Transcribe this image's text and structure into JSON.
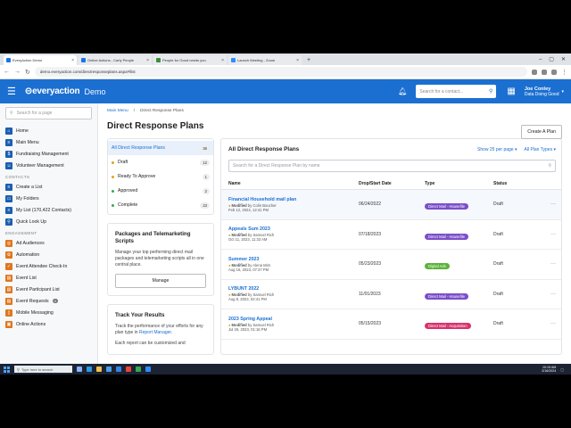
{
  "browser": {
    "tabs": [
      {
        "title": "EveryAction Demo",
        "active": true
      },
      {
        "title": "Online Actions - Carly People",
        "active": false
      },
      {
        "title": "People for Good needs you",
        "active": false
      },
      {
        "title": "Launch Meeting - Zoom",
        "active": false
      }
    ],
    "url": "demo.everyaction.com/directresponseplans.aspx#/list"
  },
  "header": {
    "logo": "everyaction",
    "logo_sub": "Demo",
    "search_placeholder": "Search for a contact...",
    "user_name": "Joe Conley",
    "user_org": "Data Doing Good"
  },
  "sidebar": {
    "search_placeholder": "Search for a page",
    "top_items": [
      "Home",
      "Main Menu",
      "Fundraising Management",
      "Volunteer Management"
    ],
    "contacts_label": "CONTACTS",
    "contacts_items": [
      "Create a List",
      "My Folders",
      "My List (170,422 Contacts)",
      "Quick Look Up"
    ],
    "engagement_label": "ENGAGEMENT",
    "engagement_items": [
      "Ad Audiences",
      "Automation",
      "Event Attendee Check-In",
      "Event List",
      "Event Participant List",
      "Event Requests",
      "Mobile Messaging",
      "Online Actions"
    ],
    "event_requests_badge": "0"
  },
  "main": {
    "breadcrumb_root": "Main Menu",
    "breadcrumb_sep": "/",
    "breadcrumb_current": "Direct Response Plans",
    "title": "Direct Response Plans",
    "create_button": "Create A Plan",
    "statuses": [
      {
        "label": "All Direct Response Plans",
        "count": "36",
        "color": ""
      },
      {
        "label": "Draft",
        "count": "12",
        "color": "#e0a21f"
      },
      {
        "label": "Ready To Approve",
        "count": "1",
        "color": "#e0a21f"
      },
      {
        "label": "Approved",
        "count": "2",
        "color": "#3aa757"
      },
      {
        "label": "Complete",
        "count": "23",
        "color": "#3aa757"
      }
    ],
    "packages_card": {
      "title": "Packages and Telemarketing Scripts",
      "body": "Manage your top performing direct mail packages and telemarketing scripts all in one central place.",
      "button": "Manage"
    },
    "results_card": {
      "title": "Track Your Results",
      "body_pre": "Track the performance of your efforts for any plan type in",
      "body_link": "Report Manager",
      "body_post": ".",
      "body2": "Each report can be customized and"
    },
    "list": {
      "title": "All Direct Response Plans",
      "per_page": "Show 25 per page ▾",
      "plan_types": "All Plan Types ▾",
      "search_placeholder": "Search for a Direct Response Plan by name",
      "columns": {
        "name": "Name",
        "date": "Drop/Start Date",
        "type": "Type",
        "status": "Status"
      },
      "rows": [
        {
          "name": "Financial Household mail plan",
          "modified": "Modified",
          "by": "by Colin Boucher",
          "when": "Feb 12, 2024, 12:41 PM",
          "date": "06/24/2022",
          "type": "Direct Mail - Housefile",
          "type_color": "#7b4fc9",
          "status": "Draft"
        },
        {
          "name": "Appeals Sum 2023",
          "modified": "Modified",
          "by": "by Samuel Rich",
          "when": "Oct 11, 2023, 11:33 AM",
          "date": "07/18/2023",
          "type": "Direct Mail - Housefile",
          "type_color": "#7b4fc9",
          "status": "Draft"
        },
        {
          "name": "Summer 2023",
          "modified": "Modified",
          "by": "by Alena Mim",
          "when": "Aug 16, 2023, 07:37 PM",
          "date": "05/23/2023",
          "type": "Digital Ads",
          "type_color": "#5bb33a",
          "status": "Draft"
        },
        {
          "name": "LYBUNT 2022",
          "modified": "Modified",
          "by": "by Samuel Rich",
          "when": "Aug 8, 2023, 02:41 PM",
          "date": "11/01/2023",
          "type": "Direct Mail - Housefile",
          "type_color": "#7b4fc9",
          "status": "Draft"
        },
        {
          "name": "2023 Spring Appeal",
          "modified": "Modified",
          "by": "by Samuel Rich",
          "when": "Jul 26, 2023, 01:16 PM",
          "date": "05/15/2023",
          "type": "Direct Mail - Acquisition",
          "type_color": "#d6336c",
          "status": "Draft"
        }
      ]
    }
  },
  "taskbar": {
    "search_placeholder": "Type here to search",
    "time": "10:15 AM",
    "date": "2/16/2024"
  }
}
